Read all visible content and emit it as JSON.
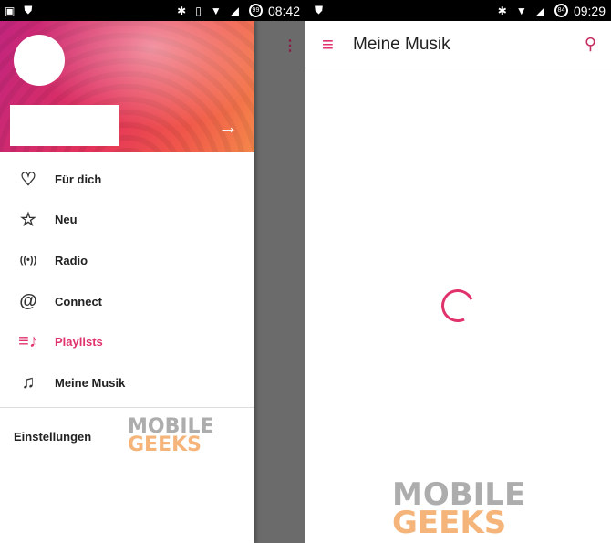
{
  "left_screen": {
    "status": {
      "time": "08:42",
      "battery": "99"
    },
    "drawer": {
      "items": [
        {
          "label": "Für dich",
          "icon": "heart-icon",
          "glyph": "♡"
        },
        {
          "label": "Neu",
          "icon": "star-icon",
          "glyph": "☆"
        },
        {
          "label": "Radio",
          "icon": "radio-icon",
          "glyph": "((•))"
        },
        {
          "label": "Connect",
          "icon": "at-icon",
          "glyph": "@"
        },
        {
          "label": "Playlists",
          "icon": "playlist-icon",
          "glyph": "≡♪",
          "active": true
        },
        {
          "label": "Meine Musik",
          "icon": "music-note-icon",
          "glyph": "♫"
        }
      ],
      "settings": "Einstellungen"
    }
  },
  "right_screen": {
    "status": {
      "time": "09:29",
      "battery": "84"
    },
    "title": "Meine Musik"
  },
  "watermark": {
    "line1": "MOBILE",
    "line2": "GEEKS"
  },
  "colors": {
    "accent": "#e0326b"
  }
}
